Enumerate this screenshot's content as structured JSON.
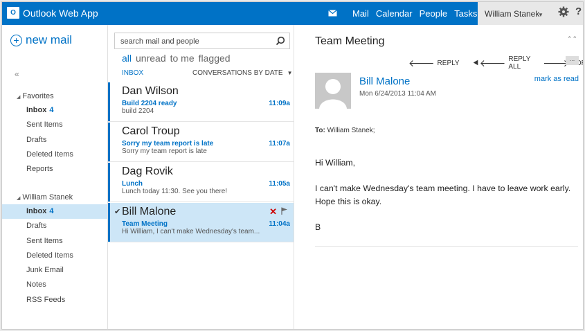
{
  "app": {
    "logo_mark": "O",
    "title": "Outlook Web App"
  },
  "topnav": {
    "links": [
      "Mail",
      "Calendar",
      "People",
      "Tasks"
    ],
    "user": "William Stanek",
    "help": "?"
  },
  "leftnav": {
    "new_mail": "new mail",
    "collapse": "«",
    "favorites": {
      "title": "Favorites",
      "items": [
        {
          "label": "Inbox",
          "count": "4"
        },
        {
          "label": "Sent Items",
          "count": ""
        },
        {
          "label": "Drafts",
          "count": ""
        },
        {
          "label": "Deleted Items",
          "count": ""
        },
        {
          "label": "Reports",
          "count": ""
        }
      ]
    },
    "account": {
      "title": "William Stanek",
      "items": [
        {
          "label": "Inbox",
          "count": "4"
        },
        {
          "label": "Drafts",
          "count": ""
        },
        {
          "label": "Sent Items",
          "count": ""
        },
        {
          "label": "Deleted Items",
          "count": ""
        },
        {
          "label": "Junk Email",
          "count": ""
        },
        {
          "label": "Notes",
          "count": ""
        },
        {
          "label": "RSS Feeds",
          "count": ""
        }
      ]
    }
  },
  "list": {
    "search_placeholder": "search mail and people",
    "filters": [
      "all",
      "unread",
      "to me",
      "flagged"
    ],
    "folder": "INBOX",
    "sort": "CONVERSATIONS BY DATE",
    "messages": [
      {
        "sender": "Dan Wilson",
        "subject": "Build 2204 ready",
        "preview": "build 2204",
        "time": "11:09a"
      },
      {
        "sender": "Carol Troup",
        "subject": "Sorry my team report is late",
        "preview": "Sorry my team report is late",
        "time": "11:07a"
      },
      {
        "sender": "Dag Rovik",
        "subject": "Lunch",
        "preview": "Lunch today 11:30. See you there!",
        "time": "11:05a"
      },
      {
        "sender": "Bill Malone",
        "subject": "Team Meeting",
        "preview": "Hi William, I can't make Wednesday's team...",
        "time": "11:04a"
      }
    ]
  },
  "reading": {
    "title": "Team Meeting",
    "actions": {
      "reply": "REPLY",
      "reply_all": "REPLY ALL",
      "forward": "FORWARD",
      "more": "..."
    },
    "sender": "Bill Malone",
    "date": "Mon 6/24/2013 11:04 AM",
    "mark_read": "mark as read",
    "to_label": "To:",
    "to_value": "William Stanek;",
    "body": [
      "Hi William,",
      "I can't make Wednesday's team meeting. I have to leave work early. Hope this is okay.",
      "B"
    ]
  },
  "colors": {
    "accent": "#0072c6",
    "selected": "#cde6f7",
    "delete": "#cc0000"
  }
}
